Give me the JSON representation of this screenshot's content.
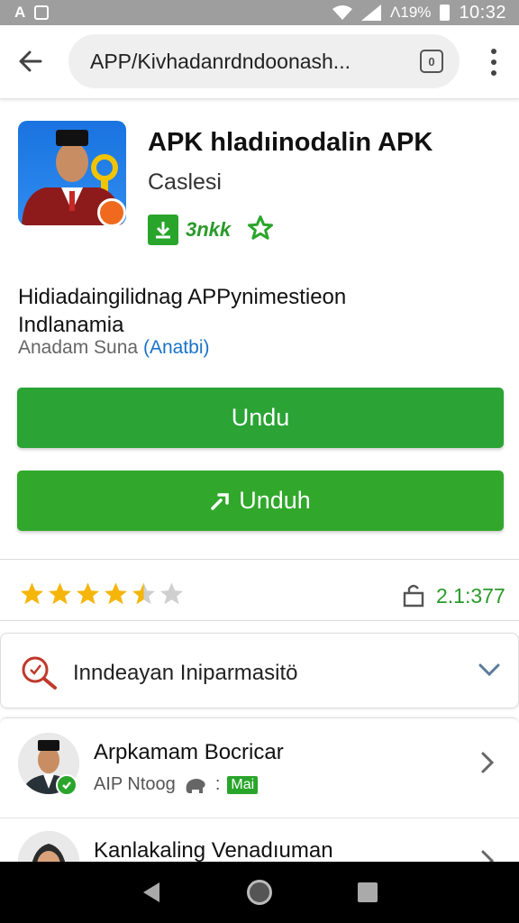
{
  "status_bar": {
    "left_glyphs": [
      "A"
    ],
    "signal_text": "Λ19%",
    "time": "10:32"
  },
  "browser": {
    "url": "APP/Kivhadanrdndoonash...",
    "tab_count": "0"
  },
  "app": {
    "title": "APK hladıinodalin APK",
    "developer": "Caslesi",
    "meta_text": "3nkk",
    "description_line1": "Hidiadaingilidnag APPynimestieon",
    "description_line2": "Indlanamia",
    "author_label": "Anadam Suna",
    "author_link": "(Anatbi)"
  },
  "buttons": {
    "primary_label": "Undu",
    "secondary_label": "Unduh"
  },
  "rating": {
    "stars_filled": 4.5,
    "stars_total": 5,
    "download_count": "2.1:377"
  },
  "info": {
    "label": "Inndeayan Iniparmasitö"
  },
  "list": {
    "items": [
      {
        "title": "Arpkamam Bocricar",
        "subtitle": "AIP Ntoog",
        "separator": ":",
        "tag": "Mai"
      },
      {
        "title": "Kanlakaling Venadıuman"
      }
    ]
  },
  "colors": {
    "green": "#2ba335",
    "accent_orange": "#ef6a1f",
    "link_blue": "#1a73c8",
    "star_gold": "#f5b50a"
  }
}
